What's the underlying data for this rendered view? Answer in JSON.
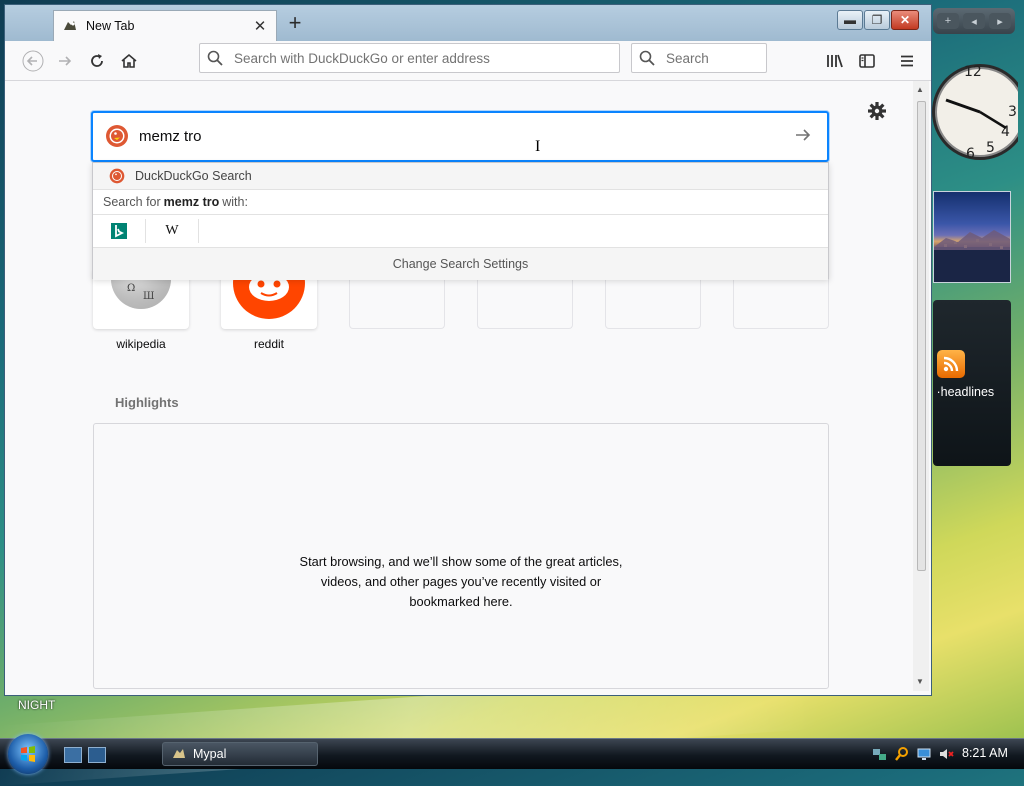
{
  "browser": {
    "tab": {
      "title": "New Tab"
    },
    "toolbar": {
      "url_placeholder": "Search with DuckDuckGo or enter address",
      "search_placeholder": "Search"
    }
  },
  "newtab": {
    "search": {
      "query": "memz tro"
    },
    "dropdown": {
      "engine_label": "DuckDuckGo Search",
      "search_for_prefix": "Search for",
      "search_for_query": "memz tro",
      "search_for_suffix": "with:",
      "engines": [
        "bing-icon",
        "wikipedia-icon"
      ],
      "wiki_glyph": "W",
      "change_settings": "Change Search Settings"
    },
    "top_sites": [
      {
        "label": "wikipedia"
      },
      {
        "label": "reddit"
      },
      {
        "label": ""
      },
      {
        "label": ""
      },
      {
        "label": ""
      },
      {
        "label": ""
      }
    ],
    "highlights": {
      "title": "Highlights",
      "empty_line1": "Start browsing, and we’ll show some of the great articles,",
      "empty_line2": "videos, and other pages you’ve recently visited or",
      "empty_line3": "bookmarked here."
    }
  },
  "desktop": {
    "night_label": "NIGHT",
    "feed_headline": "headlines",
    "clock_numerals": [
      "12",
      "3",
      "4",
      "5",
      "6"
    ]
  },
  "taskbar": {
    "task_label": "Mypal",
    "time": "8:21 AM"
  },
  "colors": {
    "accent": "#0a84ff",
    "ddg_orange": "#de5833",
    "reddit_orange": "#ff4500",
    "bing_teal": "#008373"
  }
}
